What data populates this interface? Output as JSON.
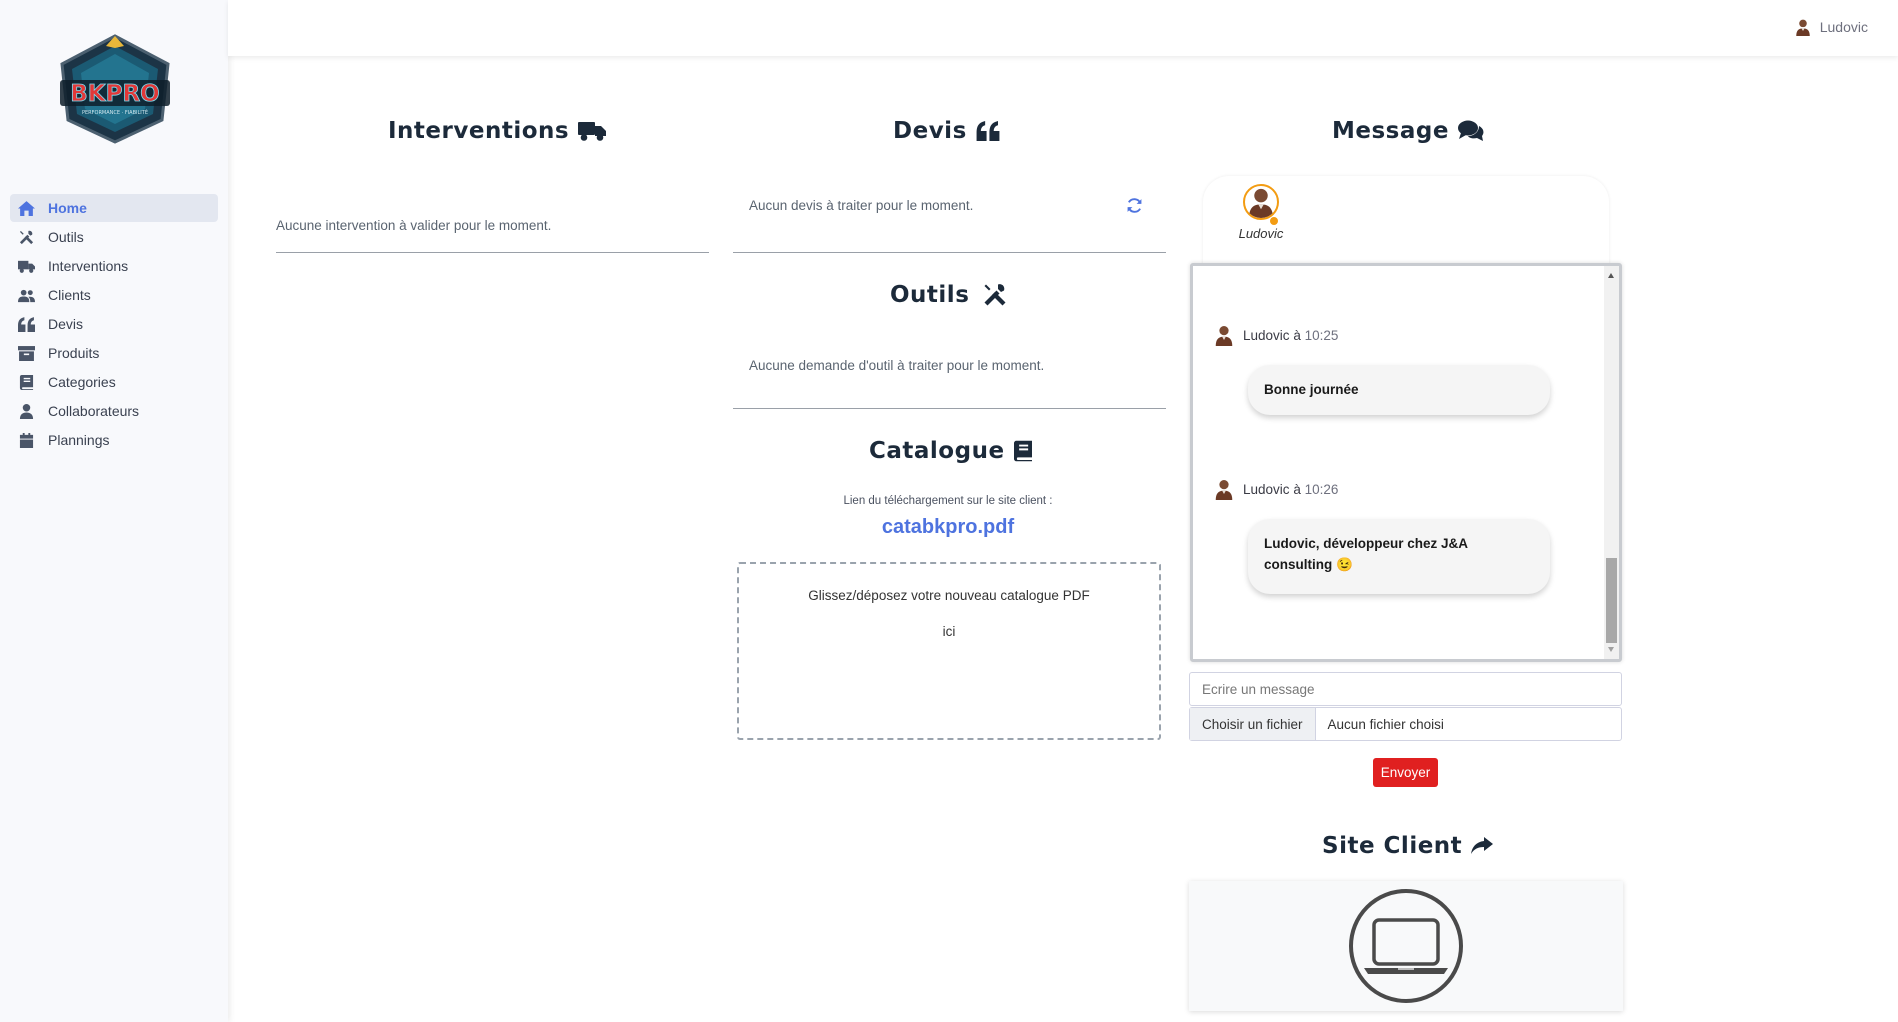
{
  "brand": {
    "logo_text": "BKPRO",
    "logo_subtitle": "PERFORMANCE · FIABILITÉ"
  },
  "topbar": {
    "user_name": "Ludovic"
  },
  "sidebar": {
    "items": [
      {
        "label": "Home",
        "icon": "home-icon",
        "active": true
      },
      {
        "label": "Outils",
        "icon": "tools-icon"
      },
      {
        "label": "Interventions",
        "icon": "truck-icon"
      },
      {
        "label": "Clients",
        "icon": "users-icon"
      },
      {
        "label": "Devis",
        "icon": "quote-icon"
      },
      {
        "label": "Produits",
        "icon": "archive-icon"
      },
      {
        "label": "Categories",
        "icon": "book-icon"
      },
      {
        "label": "Collaborateurs",
        "icon": "user-icon"
      },
      {
        "label": "Plannings",
        "icon": "calendar-icon"
      }
    ]
  },
  "interventions": {
    "title": "Interventions",
    "empty": "Aucune intervention à valider pour le moment."
  },
  "devis": {
    "title": "Devis",
    "empty": "Aucun devis à traiter pour le moment."
  },
  "outils": {
    "title": "Outils",
    "empty": "Aucune demande d'outil à traiter pour le moment."
  },
  "catalogue": {
    "title": "Catalogue",
    "download_label": "Lien du téléchargement sur le site client :",
    "file_link": "catabkpro.pdf",
    "dropzone_line1": "Glissez/déposez votre nouveau catalogue PDF",
    "dropzone_line2": "ici"
  },
  "message": {
    "title": "Message",
    "contact_name": "Ludovic",
    "messages": [
      {
        "author": "Ludovic",
        "sep": "à",
        "time": "10:25",
        "text": "Bonne journée"
      },
      {
        "author": "Ludovic",
        "sep": "à",
        "time": "10:26",
        "text": "Ludovic, développeur chez J&A consulting 😉"
      }
    ],
    "input_placeholder": "Ecrire un message",
    "file_button": "Choisir un fichier",
    "file_none": "Aucun fichier choisi",
    "send_label": "Envoyer"
  },
  "site_client": {
    "title": "Site Client"
  },
  "colors": {
    "primary": "#4e73df",
    "danger": "#e02020",
    "heading": "#1c2a3a",
    "online": "#f39c12"
  }
}
